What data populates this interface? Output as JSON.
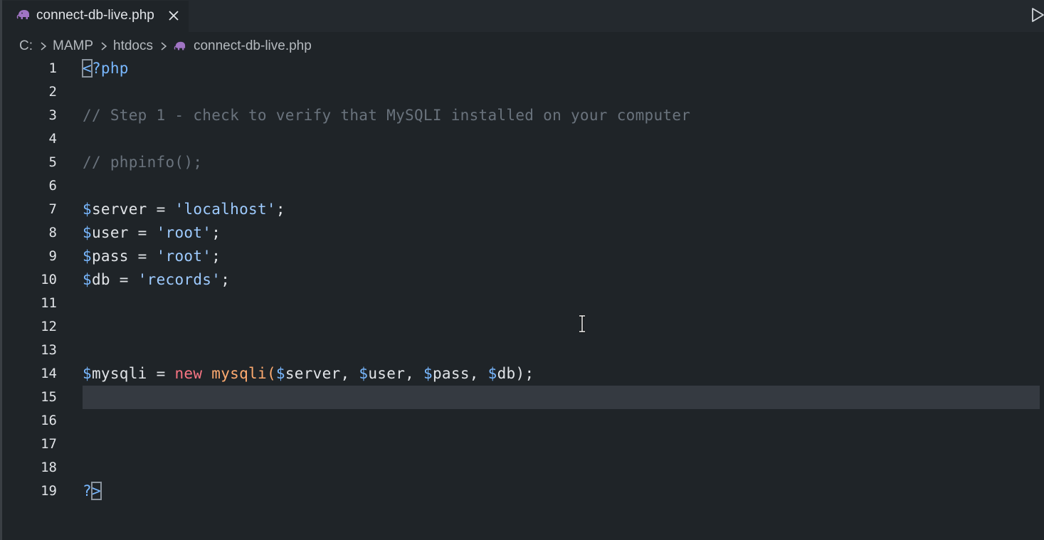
{
  "tab": {
    "filename": "connect-db-live.php",
    "icon": "php-elephant-icon",
    "close_icon": "close-icon"
  },
  "toolbar": {
    "run_icon": "run-icon"
  },
  "breadcrumb": {
    "items": [
      "C:",
      "MAMP",
      "htdocs"
    ],
    "file": "connect-db-live.php"
  },
  "editor": {
    "current_line": 15,
    "line_numbers": [
      "1",
      "2",
      "3",
      "4",
      "5",
      "6",
      "7",
      "8",
      "9",
      "10",
      "11",
      "12",
      "13",
      "14",
      "15",
      "16",
      "17",
      "18",
      "19"
    ],
    "lines": [
      [
        {
          "t": "<",
          "c": "tag",
          "box": true
        },
        {
          "t": "?php",
          "c": "tag"
        }
      ],
      [],
      [
        {
          "t": "// Step 1 - check to verify that MySQLI installed on your computer",
          "c": "comment"
        }
      ],
      [],
      [
        {
          "t": "// phpinfo();",
          "c": "comment"
        }
      ],
      [],
      [
        {
          "t": "$",
          "c": "dollar"
        },
        {
          "t": "server",
          "c": "var"
        },
        {
          "t": " = ",
          "c": "op"
        },
        {
          "t": "'localhost'",
          "c": "str"
        },
        {
          "t": ";",
          "c": "punct"
        }
      ],
      [
        {
          "t": "$",
          "c": "dollar"
        },
        {
          "t": "user",
          "c": "var"
        },
        {
          "t": " = ",
          "c": "op"
        },
        {
          "t": "'root'",
          "c": "str"
        },
        {
          "t": ";",
          "c": "punct"
        }
      ],
      [
        {
          "t": "$",
          "c": "dollar"
        },
        {
          "t": "pass",
          "c": "var"
        },
        {
          "t": " = ",
          "c": "op"
        },
        {
          "t": "'root'",
          "c": "str"
        },
        {
          "t": ";",
          "c": "punct"
        }
      ],
      [
        {
          "t": "$",
          "c": "dollar"
        },
        {
          "t": "db",
          "c": "var"
        },
        {
          "t": " = ",
          "c": "op"
        },
        {
          "t": "'records'",
          "c": "str"
        },
        {
          "t": ";",
          "c": "punct"
        }
      ],
      [],
      [],
      [],
      [
        {
          "t": "$",
          "c": "dollar"
        },
        {
          "t": "mysqli",
          "c": "var"
        },
        {
          "t": " = ",
          "c": "op"
        },
        {
          "t": "new",
          "c": "kw"
        },
        {
          "t": " ",
          "c": "op"
        },
        {
          "t": "mysqli",
          "c": "fn"
        },
        {
          "t": "(",
          "c": "fn"
        },
        {
          "t": "$",
          "c": "dollar"
        },
        {
          "t": "server",
          "c": "var"
        },
        {
          "t": ", ",
          "c": "punct"
        },
        {
          "t": "$",
          "c": "dollar"
        },
        {
          "t": "user",
          "c": "var"
        },
        {
          "t": ", ",
          "c": "punct"
        },
        {
          "t": "$",
          "c": "dollar"
        },
        {
          "t": "pass",
          "c": "var"
        },
        {
          "t": ", ",
          "c": "punct"
        },
        {
          "t": "$",
          "c": "dollar"
        },
        {
          "t": "db",
          "c": "var"
        },
        {
          "t": ");",
          "c": "punct"
        }
      ],
      [],
      [],
      [],
      [],
      [
        {
          "t": "?",
          "c": "tag"
        },
        {
          "t": ">",
          "c": "tag",
          "box": true
        }
      ]
    ]
  },
  "mouse_cursor_icon": "text-cursor-icon"
}
